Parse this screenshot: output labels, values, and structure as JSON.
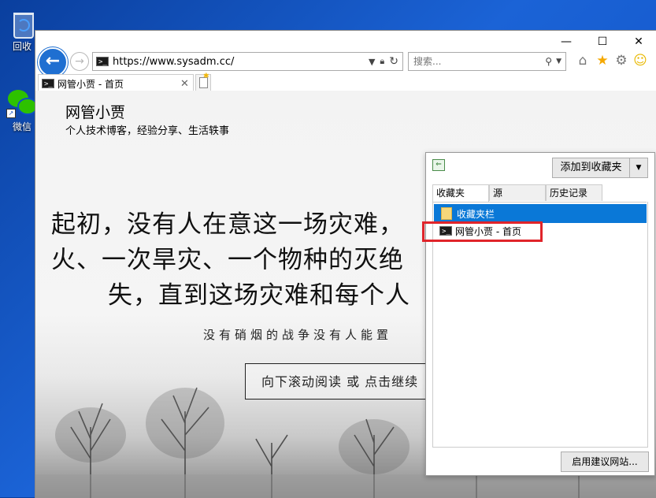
{
  "desktop": {
    "recycle_bin_label": "回收",
    "wechat_label": "微信"
  },
  "window": {
    "min_symbol": "—",
    "max_symbol": "☐",
    "close_symbol": "✕"
  },
  "nav": {
    "back_symbol": "←",
    "forward_symbol": "→",
    "url": "https://www.sysadm.cc/",
    "search_placeholder": "搜索...",
    "search_value": ""
  },
  "tab": {
    "title": "网管小贾 - 首页",
    "close_symbol": "✕"
  },
  "page": {
    "site_title": "网管小贾",
    "site_subtitle": "个人技术博客，经验分享、生活轶事",
    "hero_line1": "起初，没有人在意这一场灾难，",
    "hero_line2": "火、一次旱灾、一个物种的灭绝",
    "hero_line3": "失，直到这场灾难和每个人",
    "hero_sub": "没有硝烟的战争没有人能置",
    "cta": "向下滚动阅读 或 点击继续"
  },
  "favorites_panel": {
    "add_button": "添加到收藏夹",
    "tabs": [
      {
        "label": "收藏夹",
        "active": true
      },
      {
        "label": "源",
        "active": false
      },
      {
        "label": "历史记录",
        "active": false
      }
    ],
    "folder": "收藏夹栏",
    "entry": "网管小贾 - 首页",
    "suggest_button": "启用建议网站..."
  },
  "colors": {
    "accent": "#0a78d7",
    "highlight": "#e0242a",
    "back_button": "#1f6fd1"
  }
}
